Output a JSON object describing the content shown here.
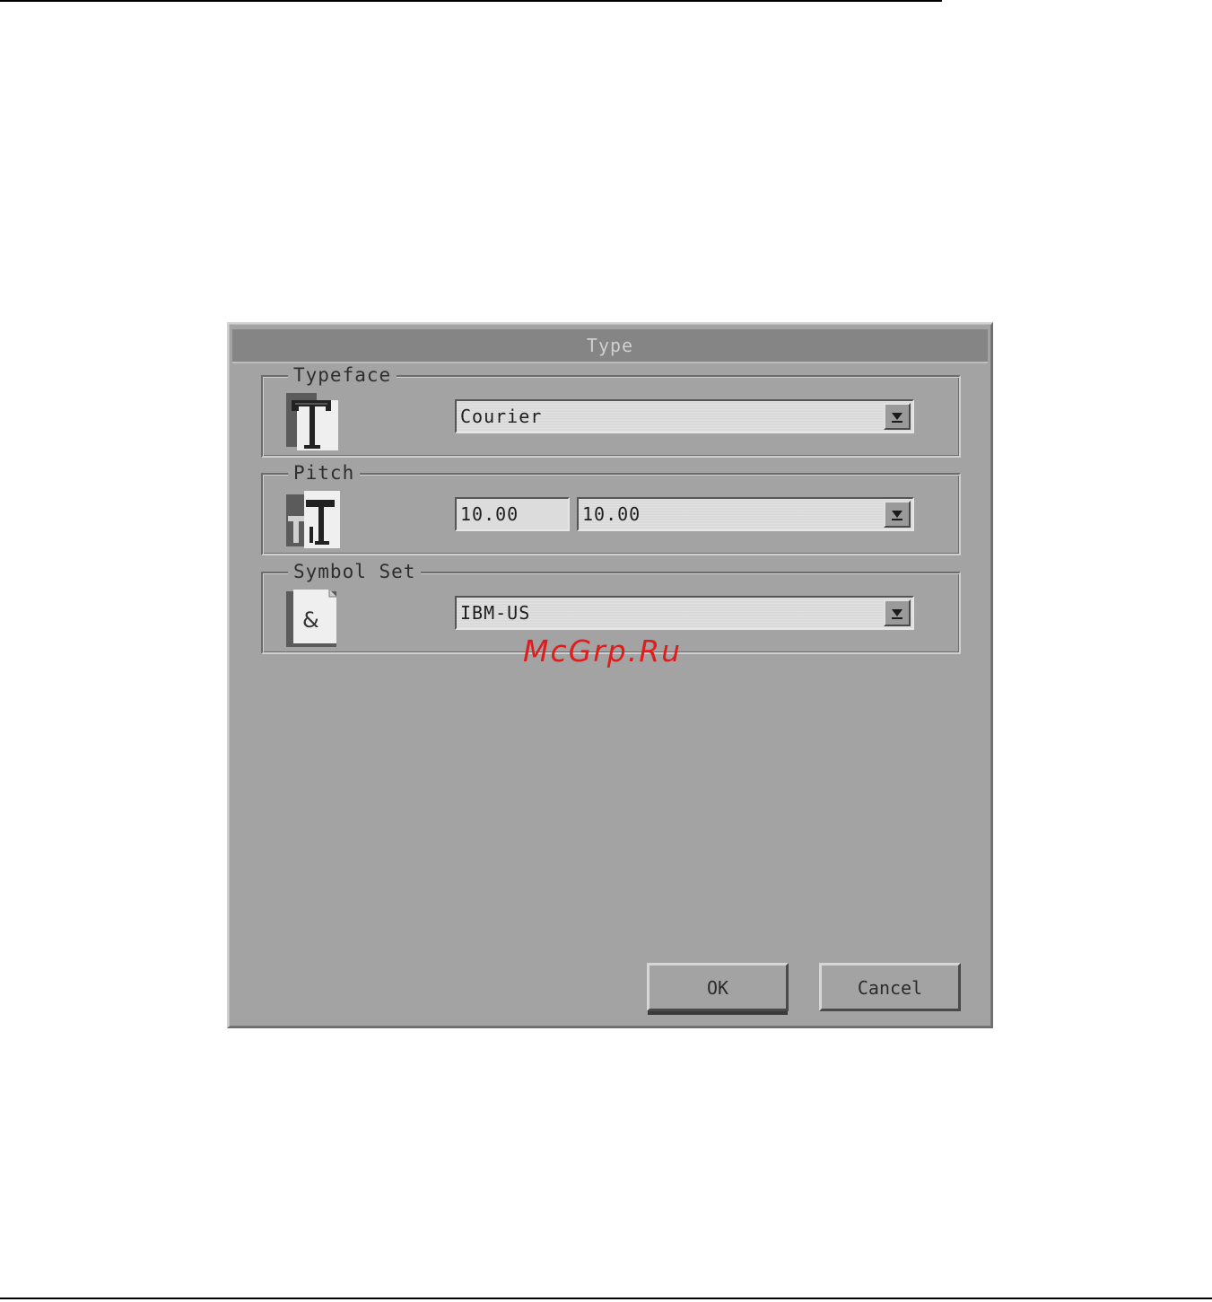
{
  "dialog": {
    "title": "Type",
    "typeface": {
      "legend": "Typeface",
      "icon": "typeface-icon",
      "selected": "Courier"
    },
    "pitch": {
      "legend": "Pitch",
      "icon": "pitch-icon",
      "entry_value": "10.00",
      "selected": "10.00"
    },
    "symbol_set": {
      "legend": "Symbol Set",
      "icon": "symbol-set-icon",
      "selected": "IBM-US"
    },
    "buttons": {
      "ok": "OK",
      "cancel": "Cancel"
    }
  },
  "watermark": "McGrp.Ru"
}
